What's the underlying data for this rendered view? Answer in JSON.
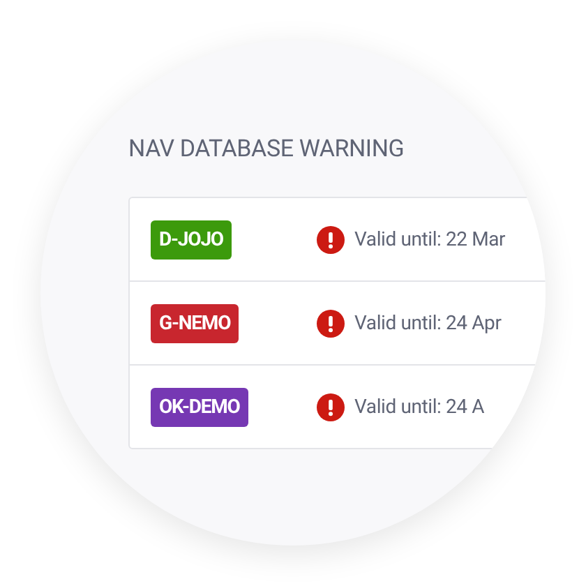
{
  "title": "NAV DATABASE WARNING",
  "rows": [
    {
      "registration": "D-JOJO",
      "color": "#3c9a0c",
      "message": "Valid until: 22 Mar"
    },
    {
      "registration": "G-NEMO",
      "color": "#c8262e",
      "message": "Valid until: 24 Apr"
    },
    {
      "registration": "OK-DEMO",
      "color": "#7638b3",
      "message": "Valid until: 24 A"
    }
  ]
}
